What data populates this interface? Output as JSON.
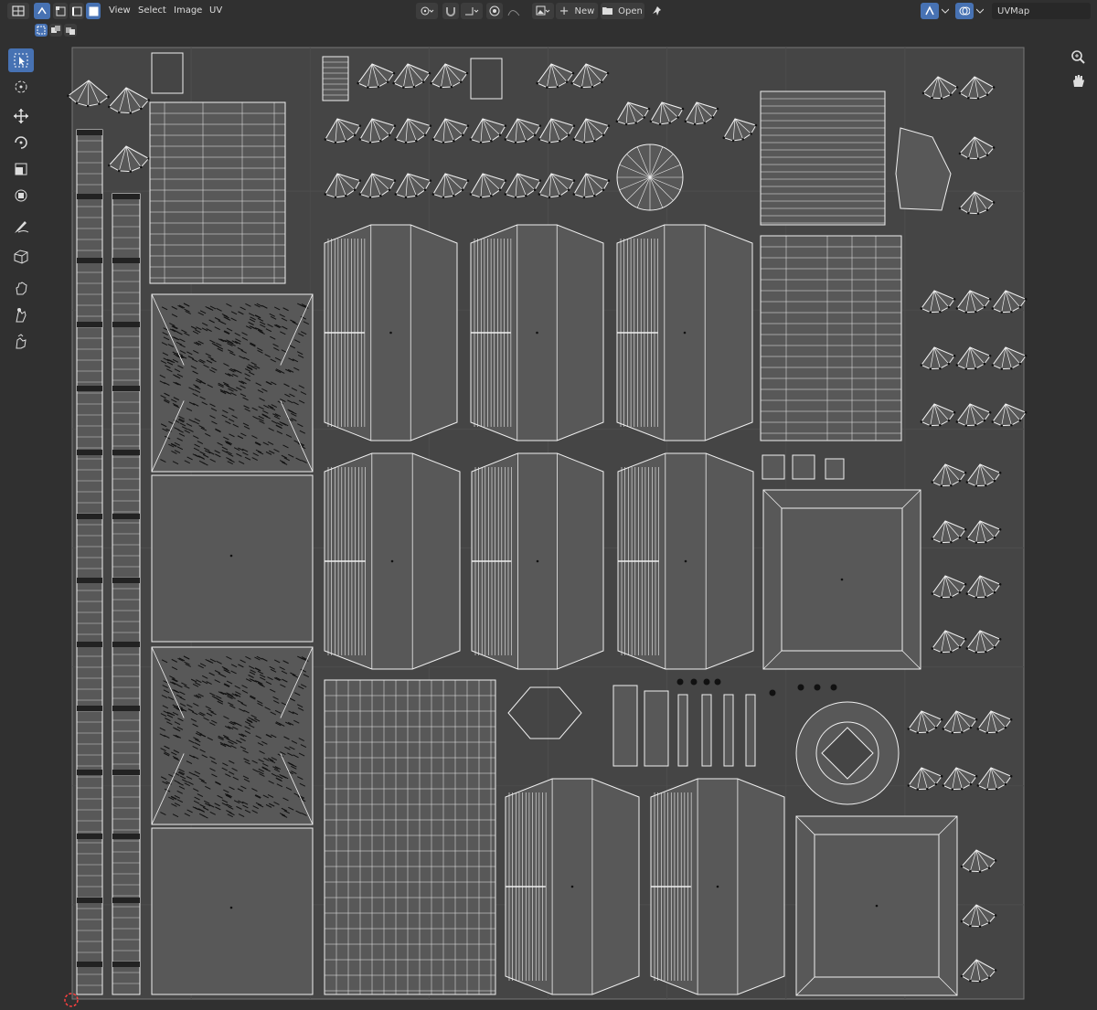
{
  "header": {
    "menus": [
      "View",
      "Select",
      "Image",
      "UV"
    ],
    "new_label": "New",
    "open_label": "Open",
    "uvmap_name": "UVMap"
  },
  "icons": {
    "editor_type": "uv-editor-icon",
    "sync_selection": "sync-selection-icon",
    "vertex_mode": "vertex-select-icon",
    "edge_mode": "edge-select-icon",
    "face_mode": "face-select-icon",
    "select_box": "select-box-icon",
    "cursor": "cursor-icon",
    "move": "move-icon",
    "rotate": "rotate-icon",
    "scale": "scale-icon",
    "transform": "transform-icon",
    "annotate": "annotate-icon",
    "rip": "rip-icon",
    "grab": "grab-icon",
    "relax": "relax-icon",
    "pinch": "pinch-icon",
    "zoom": "zoom-icon",
    "pan": "hand-icon"
  },
  "colors": {
    "background": "#303030",
    "uv_area": "#454545",
    "island_fill": "#585858",
    "edge": "#f0f0f0",
    "active_tool": "#4772b3"
  }
}
